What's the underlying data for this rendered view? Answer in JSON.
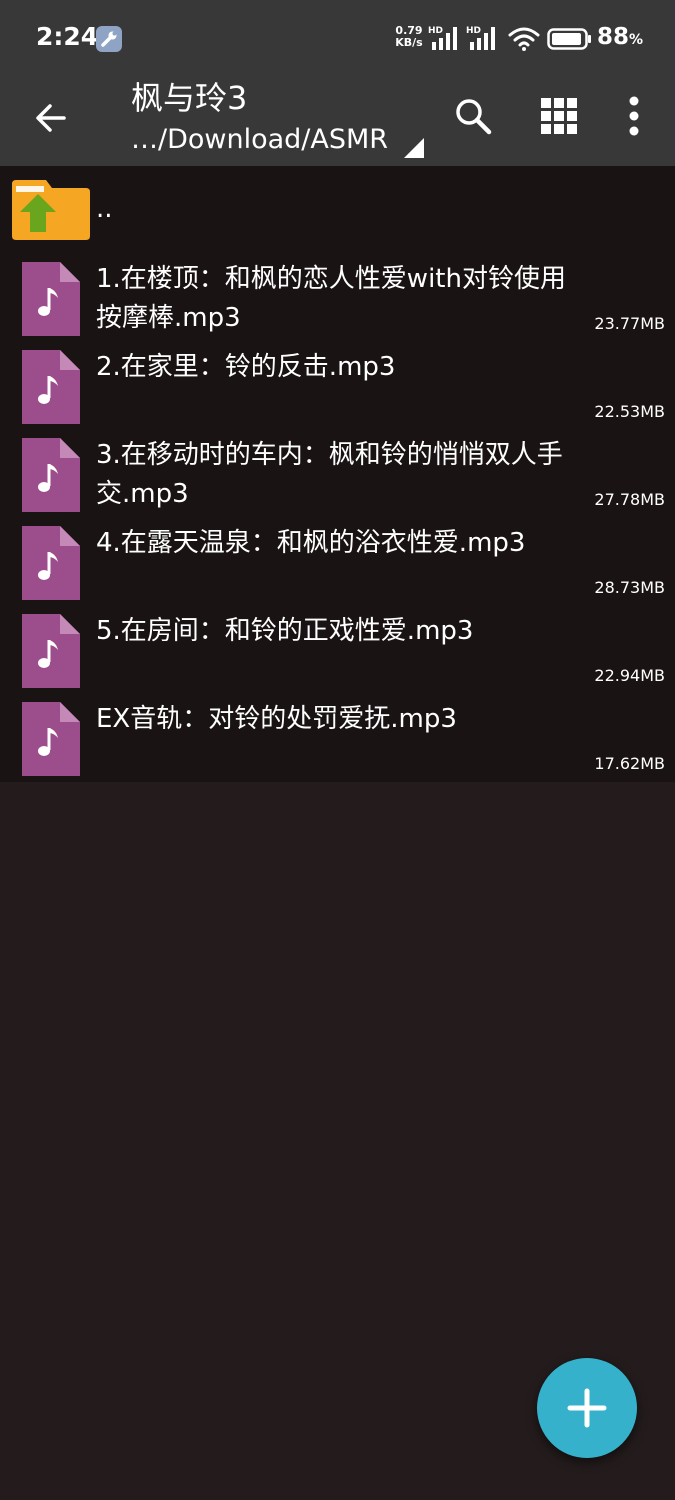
{
  "status_bar": {
    "time": "2:24",
    "net_speed_value": "0.79",
    "net_speed_unit": "KB/s",
    "signal_1_label": "HD",
    "signal_2_label": "HD",
    "battery_value": "88",
    "battery_unit": "%",
    "icons": [
      "wrench-icon",
      "signal-icon",
      "signal-icon",
      "wifi-icon",
      "battery-icon"
    ]
  },
  "app_bar": {
    "title": "枫与玲3",
    "path": "…/Download/ASMR",
    "icons": [
      "back-arrow-icon",
      "search-icon",
      "grid-view-icon",
      "more-vert-icon"
    ]
  },
  "list": {
    "parent_label": "..",
    "files": [
      {
        "name": "1.在楼顶：和枫的恋人性爱with对铃使用按摩棒.mp3",
        "size": "23.77MB"
      },
      {
        "name": "2.在家里：铃的反击.mp3",
        "size": "22.53MB"
      },
      {
        "name": "3.在移动时的车内：枫和铃的悄悄双人手交.mp3",
        "size": "27.78MB"
      },
      {
        "name": "4.在露天温泉：和枫的浴衣性爱.mp3",
        "size": "28.73MB"
      },
      {
        "name": "5.在房间：和铃的正戏性爱.mp3",
        "size": "22.94MB"
      },
      {
        "name": "EX音轨：对铃的处罚爱抚.mp3",
        "size": "17.62MB"
      }
    ]
  },
  "colors": {
    "bar_bg": "#383838",
    "list_bg": "#1a1314",
    "screen_bg": "#231b1c",
    "audio_icon": "#9c4d8c",
    "folder": "#f5a623",
    "up_arrow": "#6aa51e",
    "fab": "#36b1cc"
  }
}
